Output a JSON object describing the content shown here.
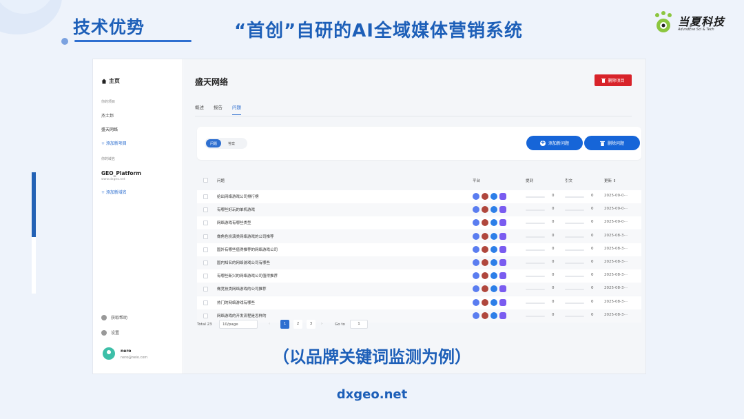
{
  "slide": {
    "section_title": "技术优势",
    "headline": "“首创”自研的AI全域媒体营销系统",
    "brand_name": "当夏科技",
    "brand_sub": "AdundEve Sci & Tech",
    "caption": "（以品牌关键词监测为例）",
    "footer_url": "dxgeo.net"
  },
  "sidebar": {
    "home": "主页",
    "projects_section": "你的项目",
    "projects": [
      "杰士邦",
      "盛天网络"
    ],
    "add_project": "+ 添加新项目",
    "domains_section": "你的域名",
    "domain_name": "GEO_Platform",
    "domain_url": "www.dxgeo.net",
    "add_domain": "+ 添加新域名",
    "help": "获取帮助",
    "settings": "设置",
    "user_name": "nero",
    "user_email": "nero@neio.com"
  },
  "main": {
    "title": "盛天网络",
    "delete_project": "删除项目",
    "tabs": [
      "概述",
      "报告",
      "问题"
    ],
    "seg_questions": "问题",
    "seg_answers": "答案",
    "add_question": "添加新问题",
    "delete_question": "删除问题",
    "columns": {
      "question": "问题",
      "platform": "平台",
      "mention": "提到",
      "citation": "引文",
      "updated": "更新 ⇕"
    }
  },
  "rows": [
    {
      "q": "给出网络游戏公司排行榜",
      "m": "0",
      "c": "0",
      "d": "2025-09-0⋯"
    },
    {
      "q": "有哪些好玩的单机游戏",
      "m": "0",
      "c": "0",
      "d": "2025-09-0⋯"
    },
    {
      "q": "网络游戏有哪些类型",
      "m": "0",
      "c": "0",
      "d": "2025-09-0⋯"
    },
    {
      "q": "做角色扮演类网络游戏的公司推荐",
      "m": "0",
      "c": "0",
      "d": "2025-08-3⋯"
    },
    {
      "q": "国外有哪些值得推荐的网络游戏公司",
      "m": "0",
      "c": "0",
      "d": "2025-08-3⋯"
    },
    {
      "q": "国内知名的网络游戏公司有哪些",
      "m": "0",
      "c": "0",
      "d": "2025-08-3⋯"
    },
    {
      "q": "有哪些新兴的网络游戏公司值得推荐",
      "m": "0",
      "c": "0",
      "d": "2025-08-3⋯"
    },
    {
      "q": "做竞技类网络游戏的公司推荐",
      "m": "0",
      "c": "0",
      "d": "2025-08-3⋯"
    },
    {
      "q": "热门的网络游戏有哪些",
      "m": "0",
      "c": "0",
      "d": "2025-08-3⋯"
    },
    {
      "q": "网络游戏的开发流程是怎样的",
      "m": "0",
      "c": "0",
      "d": "2025-08-3⋯"
    }
  ],
  "pager": {
    "total": "Total 23",
    "page_size": "10/page",
    "pages": [
      "1",
      "2",
      "3"
    ],
    "goto_label": "Go to",
    "goto_value": "1"
  }
}
